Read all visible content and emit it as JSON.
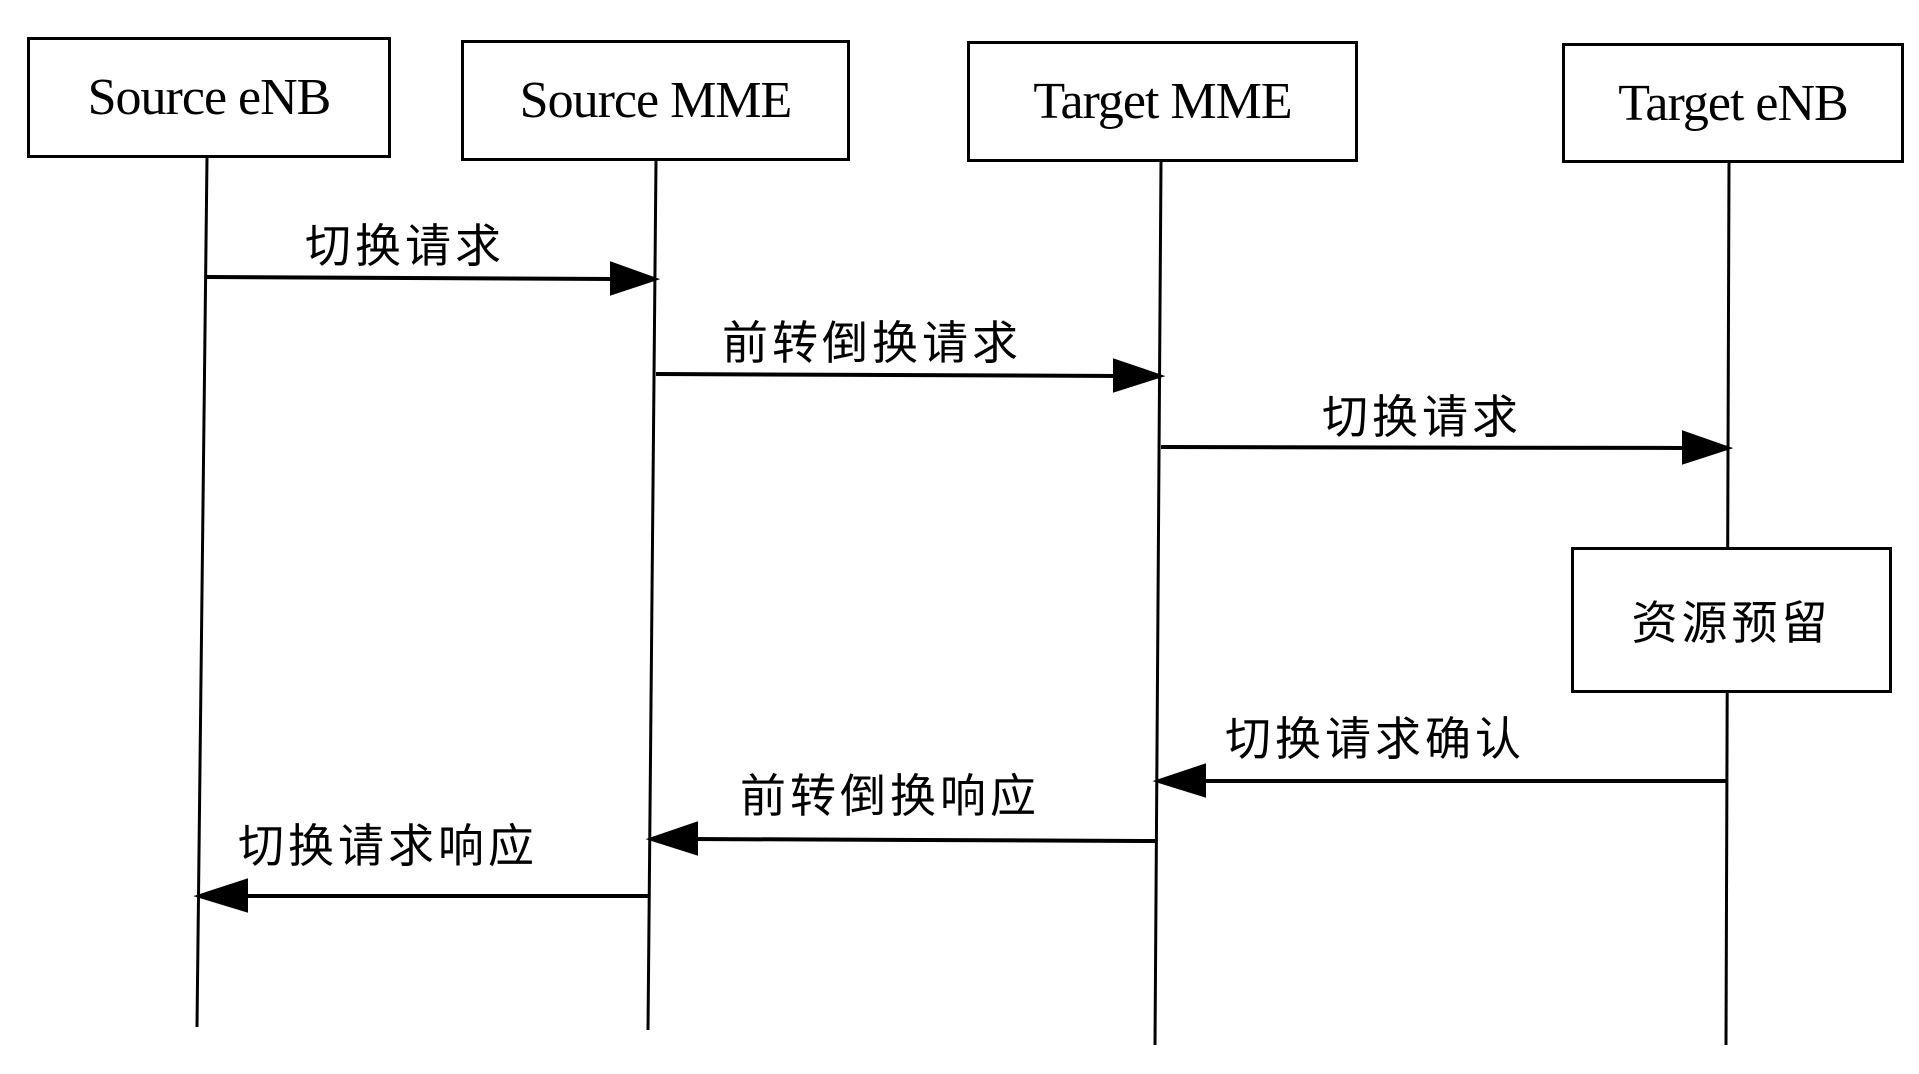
{
  "diagram": {
    "type": "sequence",
    "participants": [
      {
        "id": "source-enb",
        "label": "Source eNB"
      },
      {
        "id": "source-mme",
        "label": "Source MME"
      },
      {
        "id": "target-mme",
        "label": "Target MME"
      },
      {
        "id": "target-enb",
        "label": "Target eNB"
      }
    ],
    "messages": [
      {
        "from": "source-enb",
        "to": "source-mme",
        "label": "切换请求"
      },
      {
        "from": "source-mme",
        "to": "target-mme",
        "label": "前转倒换请求"
      },
      {
        "from": "target-mme",
        "to": "target-enb",
        "label": "切换请求"
      },
      {
        "from": "target-enb",
        "to": "target-mme",
        "label": "切换请求确认"
      },
      {
        "from": "target-mme",
        "to": "source-mme",
        "label": "前转倒换响应"
      },
      {
        "from": "source-mme",
        "to": "source-enb",
        "label": "切换请求响应"
      }
    ],
    "notes": [
      {
        "on": "target-enb",
        "label": "资源预留"
      }
    ]
  }
}
